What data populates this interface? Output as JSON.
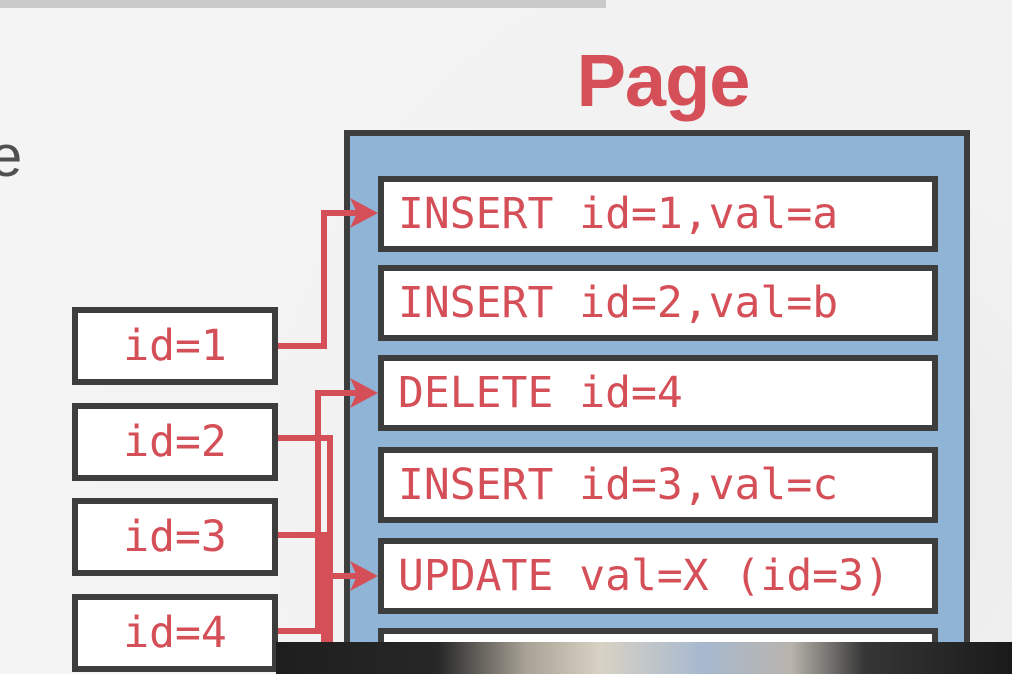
{
  "page": {
    "title": "Page",
    "cut_letter": "e"
  },
  "records": [
    {
      "text": "INSERT id=1,val=a"
    },
    {
      "text": "INSERT id=2,val=b"
    },
    {
      "text": "DELETE id=4"
    },
    {
      "text": "INSERT id=3,val=c"
    },
    {
      "text": "UPDATE val=X (id=3)"
    },
    {
      "text": ""
    }
  ],
  "ids": [
    {
      "text": "id=1"
    },
    {
      "text": "id=2"
    },
    {
      "text": "id=3"
    },
    {
      "text": "id=4"
    }
  ],
  "colors": {
    "accent": "#d44f57",
    "page_fill": "#8fb4d6",
    "border": "#3d3d3d",
    "background": "#f2f2f2"
  }
}
